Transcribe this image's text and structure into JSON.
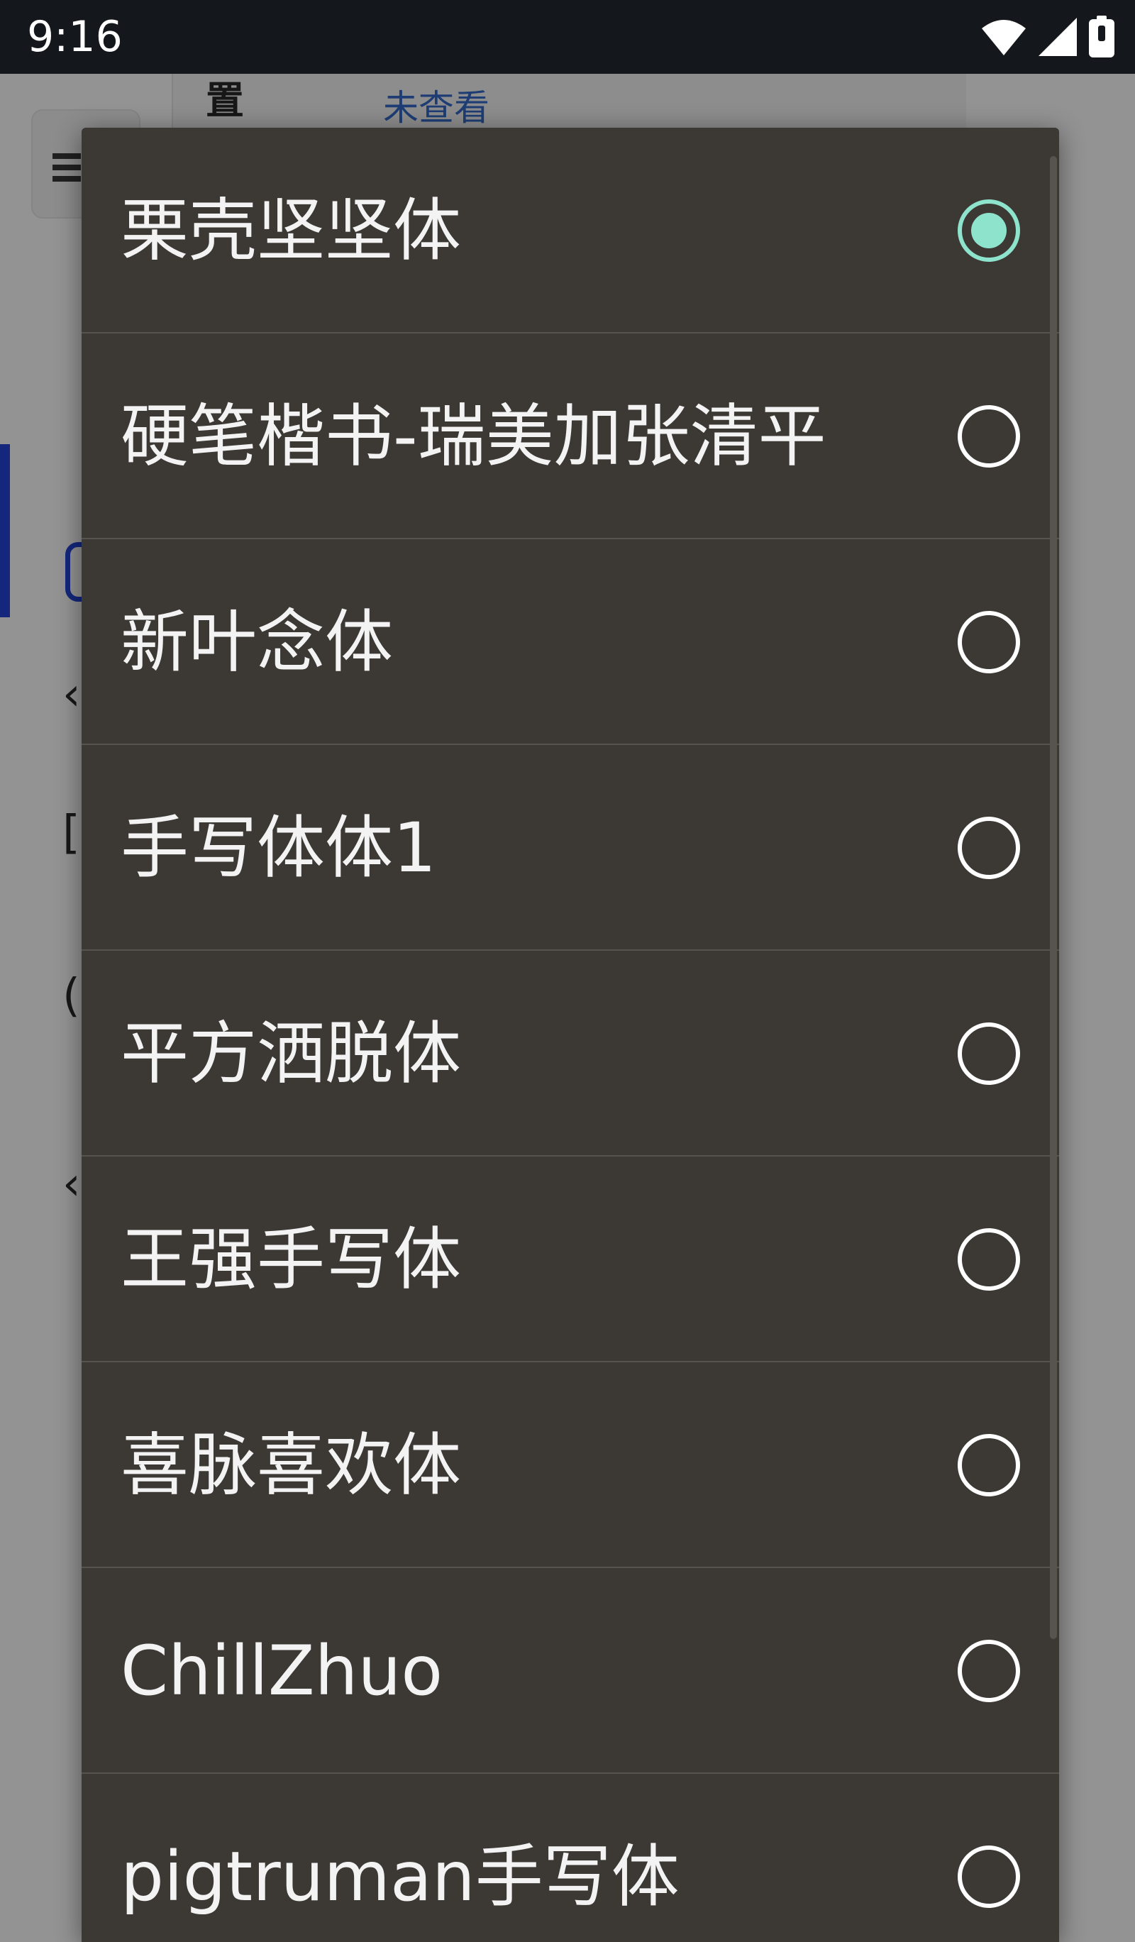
{
  "status_bar": {
    "time": "9:16",
    "icons": [
      "wifi-icon",
      "cell-signal-icon",
      "battery-icon"
    ]
  },
  "background_app": {
    "header_icon_text": "置",
    "header_link_text": "未查看",
    "menu_icon": "menu-icon"
  },
  "font_dialog": {
    "options": [
      {
        "label": "栗壳坚坚体",
        "selected": true
      },
      {
        "label": "硬笔楷书-瑞美加张清平",
        "selected": false
      },
      {
        "label": "新叶念体",
        "selected": false
      },
      {
        "label": "手写体体1",
        "selected": false
      },
      {
        "label": "平方洒脱体",
        "selected": false
      },
      {
        "label": "王强手写体",
        "selected": false
      },
      {
        "label": "喜脉喜欢体",
        "selected": false
      },
      {
        "label": "ChillZhuo",
        "selected": false
      },
      {
        "label": "pigtruman手写体",
        "selected": false
      }
    ]
  },
  "colors": {
    "dialog_background": "#3c3935",
    "divider": "#57534e",
    "radio_selected": "#8ee3cd",
    "radio_unselected": "#ffffff",
    "status_bar": "#14171b"
  }
}
